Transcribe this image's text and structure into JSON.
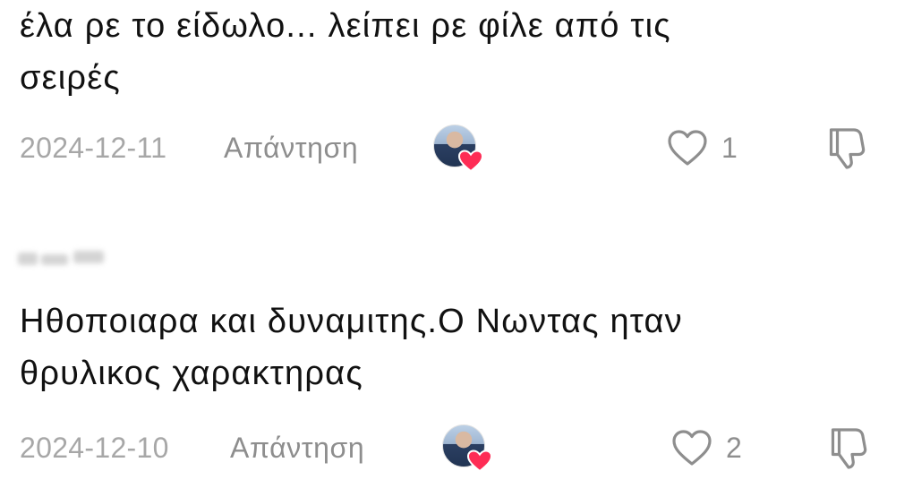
{
  "comments": [
    {
      "text_lines": [
        "έλα ρε το είδωλο... λείπει ρε φίλε από τις",
        "σειρές"
      ],
      "date": "2024-12-11",
      "reply_label": "Απάντηση",
      "like_count": "1"
    },
    {
      "text_lines": [
        "Ηθοποιαρα και δυναμιτης.Ο Νωντας ηταν",
        "θρυλικος χαρακτηρας"
      ],
      "date": "2024-12-10",
      "reply_label": "Απάντηση",
      "like_count": "2"
    }
  ],
  "icons": {
    "like": "heart-outline-icon",
    "dislike": "thumbs-down-icon",
    "creator_liked_badge": "heart-filled-icon"
  },
  "colors": {
    "text": "#111111",
    "date": "#a7a7a7",
    "secondary": "#8e8e8e",
    "heart": "#fe2c55"
  }
}
